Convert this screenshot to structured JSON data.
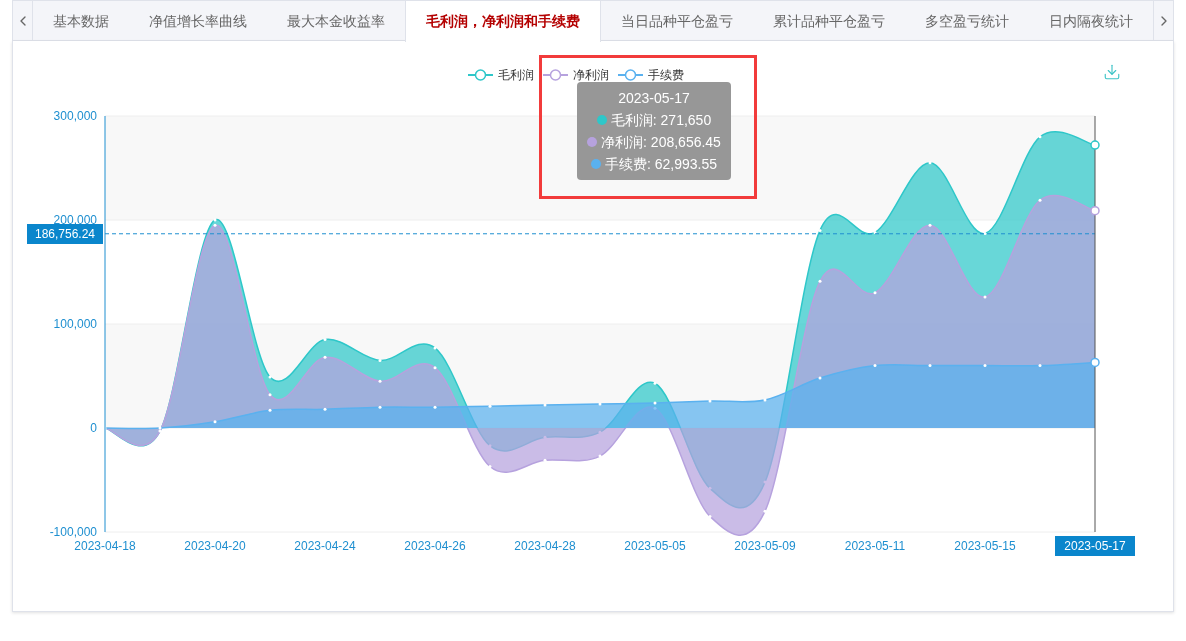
{
  "tabs": [
    {
      "label": "基本数据",
      "selected": false
    },
    {
      "label": "净值增长率曲线",
      "selected": false
    },
    {
      "label": "最大本金收益率",
      "selected": false
    },
    {
      "label": "毛利润，净利润和手续费",
      "selected": true
    },
    {
      "label": "当日品种平仓盈亏",
      "selected": false
    },
    {
      "label": "累计品种平仓盈亏",
      "selected": false
    },
    {
      "label": "多空盈亏统计",
      "selected": false
    },
    {
      "label": "日内隔夜统计",
      "selected": false
    }
  ],
  "chart": {
    "axis_pointer": {
      "at_end": true
    },
    "tooltip": {
      "title": "2023-05-17",
      "rows": [
        {
          "text": "毛利润: 271,650",
          "color": "#2ec7c9"
        },
        {
          "text": "净利润: 208,656.45",
          "color": "#b6a2de"
        },
        {
          "text": "手续费: 62,993.55",
          "color": "#5ab1ef"
        }
      ]
    },
    "chart_data": {
      "type": "area",
      "categories": [
        "2023-04-18",
        null,
        "2023-04-20",
        null,
        "2023-04-24",
        null,
        "2023-04-26",
        null,
        "2023-04-28",
        null,
        "2023-05-05",
        null,
        "2023-05-09",
        null,
        "2023-05-11",
        null,
        "2023-05-15",
        null,
        "2023-05-17"
      ],
      "grid": true,
      "ylim": [
        -100000,
        300000
      ],
      "yticks": [
        {
          "value": -100000,
          "label": "-100,000"
        },
        {
          "value": 0,
          "label": "0"
        },
        {
          "value": 100000,
          "label": "100,000"
        },
        {
          "value": 200000,
          "label": "200,000"
        },
        {
          "value": 300000,
          "label": "300,000"
        }
      ],
      "series": [
        {
          "name": "毛利润",
          "color": "#2ec7c9",
          "values": [
            0,
            -3000,
            200000,
            49000,
            85000,
            65000,
            77000,
            -17000,
            -9000,
            -4000,
            43000,
            -58000,
            -52000,
            190000,
            188000,
            255000,
            187000,
            280000,
            272000
          ]
        },
        {
          "name": "净利润",
          "color": "#b6a2de",
          "values": [
            0,
            -3000,
            195000,
            32000,
            68000,
            45000,
            58000,
            -37000,
            -31000,
            -27000,
            19000,
            -85000,
            -80000,
            141000,
            130000,
            195000,
            126000,
            219000,
            209000
          ]
        },
        {
          "name": "手续费",
          "color": "#5ab1ef",
          "values": [
            0,
            0,
            6000,
            17000,
            18000,
            20000,
            20000,
            21000,
            22000,
            23000,
            24000,
            26000,
            27000,
            48000,
            60000,
            60000,
            60000,
            60000,
            63000
          ]
        }
      ],
      "ref_lines": [
        {
          "axis": "y",
          "value": 186756.24,
          "label": "186,756.24"
        }
      ]
    }
  }
}
